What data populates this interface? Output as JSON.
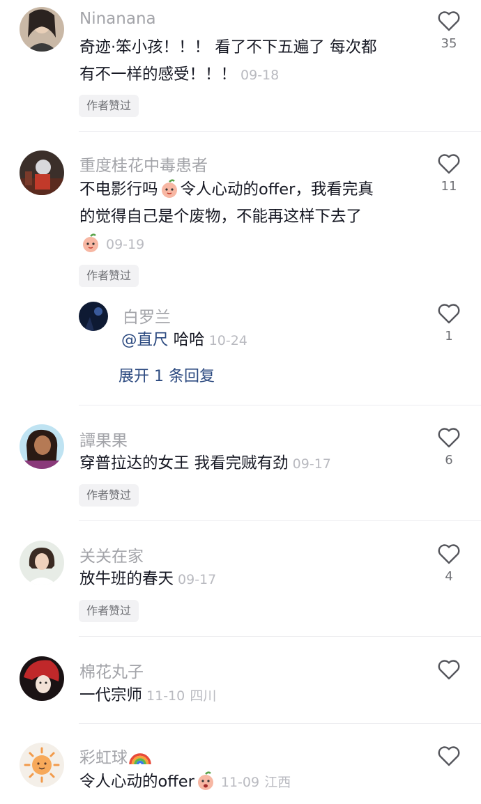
{
  "comments": [
    {
      "user": "Ninanana",
      "text_lines": [
        "奇迹·笨小孩！！！ 看了不下五遍了 每次都",
        "有不一样的感受！！！"
      ],
      "date": "09-18",
      "badge": "作者赞过",
      "likes": "35"
    },
    {
      "user": "重度桂花中毒患者",
      "text_line1_before": "不电影行吗",
      "text_line1_after": "令人心动的offer，我看完真",
      "text_line2": "的觉得自己是个废物，不能再这样下去了",
      "date": "09-19",
      "badge": "作者赞过",
      "likes": "11",
      "reply": {
        "user": "白罗兰",
        "mention": "@直尺",
        "text": "哈哈",
        "date": "10-24",
        "likes": "1",
        "expand": "展开 1 条回复"
      }
    },
    {
      "user": "譚果果",
      "text": "穿普拉达的女王 我看完贼有劲",
      "date": "09-17",
      "badge": "作者赞过",
      "likes": "6"
    },
    {
      "user": "关关在家",
      "text": "放牛班的春天",
      "date": "09-17",
      "badge": "作者赞过",
      "likes": "4"
    },
    {
      "user": "棉花丸子",
      "text": "一代宗师",
      "date": "11-10",
      "location": "四川",
      "likes": ""
    },
    {
      "user": "彩虹球",
      "text": "令人心动的offer",
      "date": "11-09",
      "location": "江西",
      "likes": ""
    }
  ],
  "icons": {
    "like": "heart-outline-icon",
    "emoji": "peach-face-emoji",
    "rainbow": "rainbow-emoji"
  },
  "colors": {
    "username": "#a3a4a9",
    "text": "#161823",
    "link": "#2c4a80",
    "badge_bg": "#f2f2f4"
  }
}
